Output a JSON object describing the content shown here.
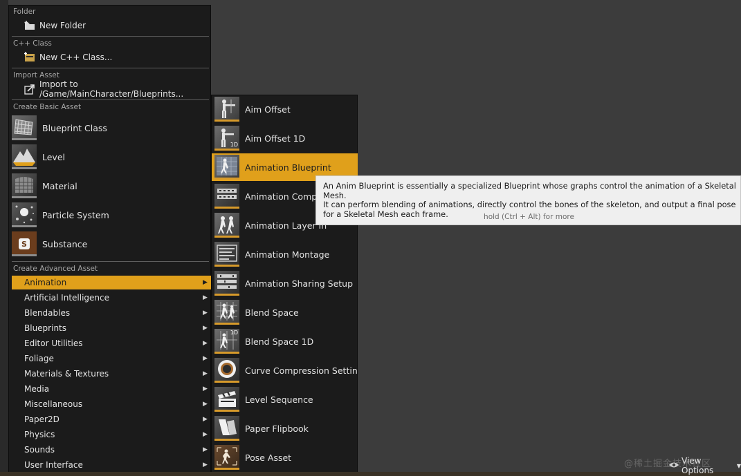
{
  "menu": {
    "folder_header": "Folder",
    "new_folder": "New Folder",
    "cpp_header": "C++ Class",
    "new_cpp": "New C++ Class...",
    "import_header": "Import Asset",
    "import_to": "Import to /Game/MainCharacter/Blueprints...",
    "basic_header": "Create Basic Asset",
    "basic_assets": [
      {
        "label": "Blueprint Class",
        "icon": "blueprint-class-icon"
      },
      {
        "label": "Level",
        "icon": "level-icon"
      },
      {
        "label": "Material",
        "icon": "material-icon"
      },
      {
        "label": "Particle System",
        "icon": "particle-system-icon"
      },
      {
        "label": "Substance",
        "icon": "substance-icon"
      }
    ],
    "advanced_header": "Create Advanced Asset",
    "categories": [
      "Animation",
      "Artificial Intelligence",
      "Blendables",
      "Blueprints",
      "Editor Utilities",
      "Foliage",
      "Materials & Textures",
      "Media",
      "Miscellaneous",
      "Paper2D",
      "Physics",
      "Sounds",
      "User Interface"
    ],
    "active_category": "Animation"
  },
  "submenu": {
    "items": [
      {
        "label": "Aim Offset",
        "icon": "aim-offset-icon"
      },
      {
        "label": "Aim Offset 1D",
        "icon": "aim-offset-1d-icon",
        "badge": "1D"
      },
      {
        "label": "Animation Blueprint",
        "icon": "animation-blueprint-icon"
      },
      {
        "label": "Animation Compos",
        "icon": "animation-composite-icon"
      },
      {
        "label": "Animation Layer In",
        "icon": "animation-layer-interface-icon"
      },
      {
        "label": "Animation Montage",
        "icon": "animation-montage-icon"
      },
      {
        "label": "Animation Sharing Setup",
        "icon": "animation-sharing-setup-icon"
      },
      {
        "label": "Blend Space",
        "icon": "blend-space-icon"
      },
      {
        "label": "Blend Space 1D",
        "icon": "blend-space-1d-icon",
        "badge": "1D"
      },
      {
        "label": "Curve Compression Settings",
        "icon": "curve-compression-icon"
      },
      {
        "label": "Level Sequence",
        "icon": "level-sequence-icon"
      },
      {
        "label": "Paper Flipbook",
        "icon": "paper-flipbook-icon"
      },
      {
        "label": "Pose Asset",
        "icon": "pose-asset-icon"
      }
    ],
    "active_item": "Animation Blueprint"
  },
  "tooltip": {
    "body": "An Anim Blueprint is essentially a specialized Blueprint whose graphs control the animation of a Skeletal Mesh.\nIt can perform blending of animations, directly control the bones of the skeleton, and output a final pose\nfor a Skeletal Mesh each frame.",
    "hint": "hold (Ctrl + Alt) for more"
  },
  "footer": {
    "view_options": "View Options",
    "watermark": "@稀土掘金技术社区"
  },
  "colors": {
    "highlight": "#e0a01b",
    "menu_bg": "#1b1b1b",
    "tooltip_bg": "#efefef"
  }
}
